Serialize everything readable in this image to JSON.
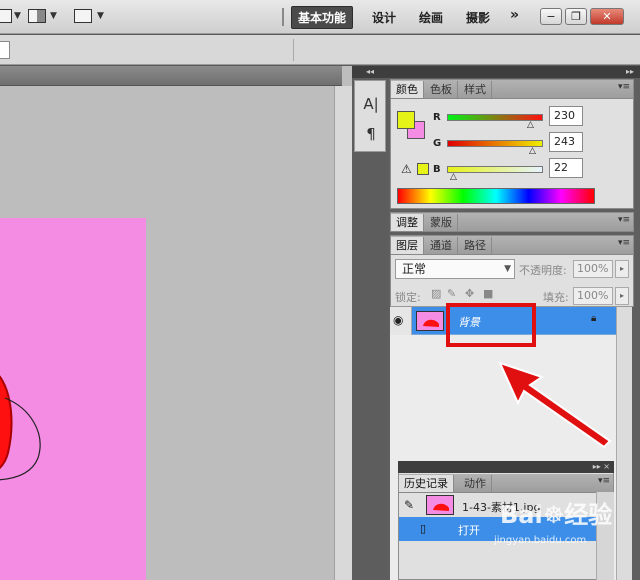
{
  "topbar": {
    "workspaces": [
      "基本功能",
      "设计",
      "绘画",
      "摄影"
    ],
    "more": "»",
    "window_buttons": [
      "−",
      "❐",
      "✕"
    ]
  },
  "color_panel": {
    "tabs": [
      "颜色",
      "色板",
      "样式"
    ],
    "foreground_color": "#e6f316",
    "background_color": "#f58ce4",
    "channels": [
      {
        "label": "R",
        "value": "230"
      },
      {
        "label": "G",
        "value": "243"
      },
      {
        "label": "B",
        "value": "22"
      }
    ],
    "warning_icon": "gamut-warning-icon"
  },
  "adjust_panel": {
    "tabs": [
      "调整",
      "蒙版"
    ]
  },
  "layers_panel": {
    "tabs": [
      "图层",
      "通道",
      "路径"
    ],
    "blend_mode": "正常",
    "opacity_label": "不透明度:",
    "opacity_value": "100%",
    "lock_label": "锁定:",
    "fill_label": "填充:",
    "fill_value": "100%",
    "layers": [
      {
        "name": "背景",
        "visible": true,
        "locked": true
      }
    ]
  },
  "history_panel": {
    "tabs": [
      "历史记录",
      "动作"
    ],
    "snapshot_name": "1-43-素材1.jpg",
    "states": [
      "打开"
    ]
  },
  "watermark": {
    "brand": "Bai",
    "brand2": "经验",
    "url": "jingyan.baidu.com"
  },
  "colors": {
    "selection_blue": "#3d8ee8",
    "highlight_red": "#e01010",
    "canvas_pink": "#f58ce4"
  }
}
